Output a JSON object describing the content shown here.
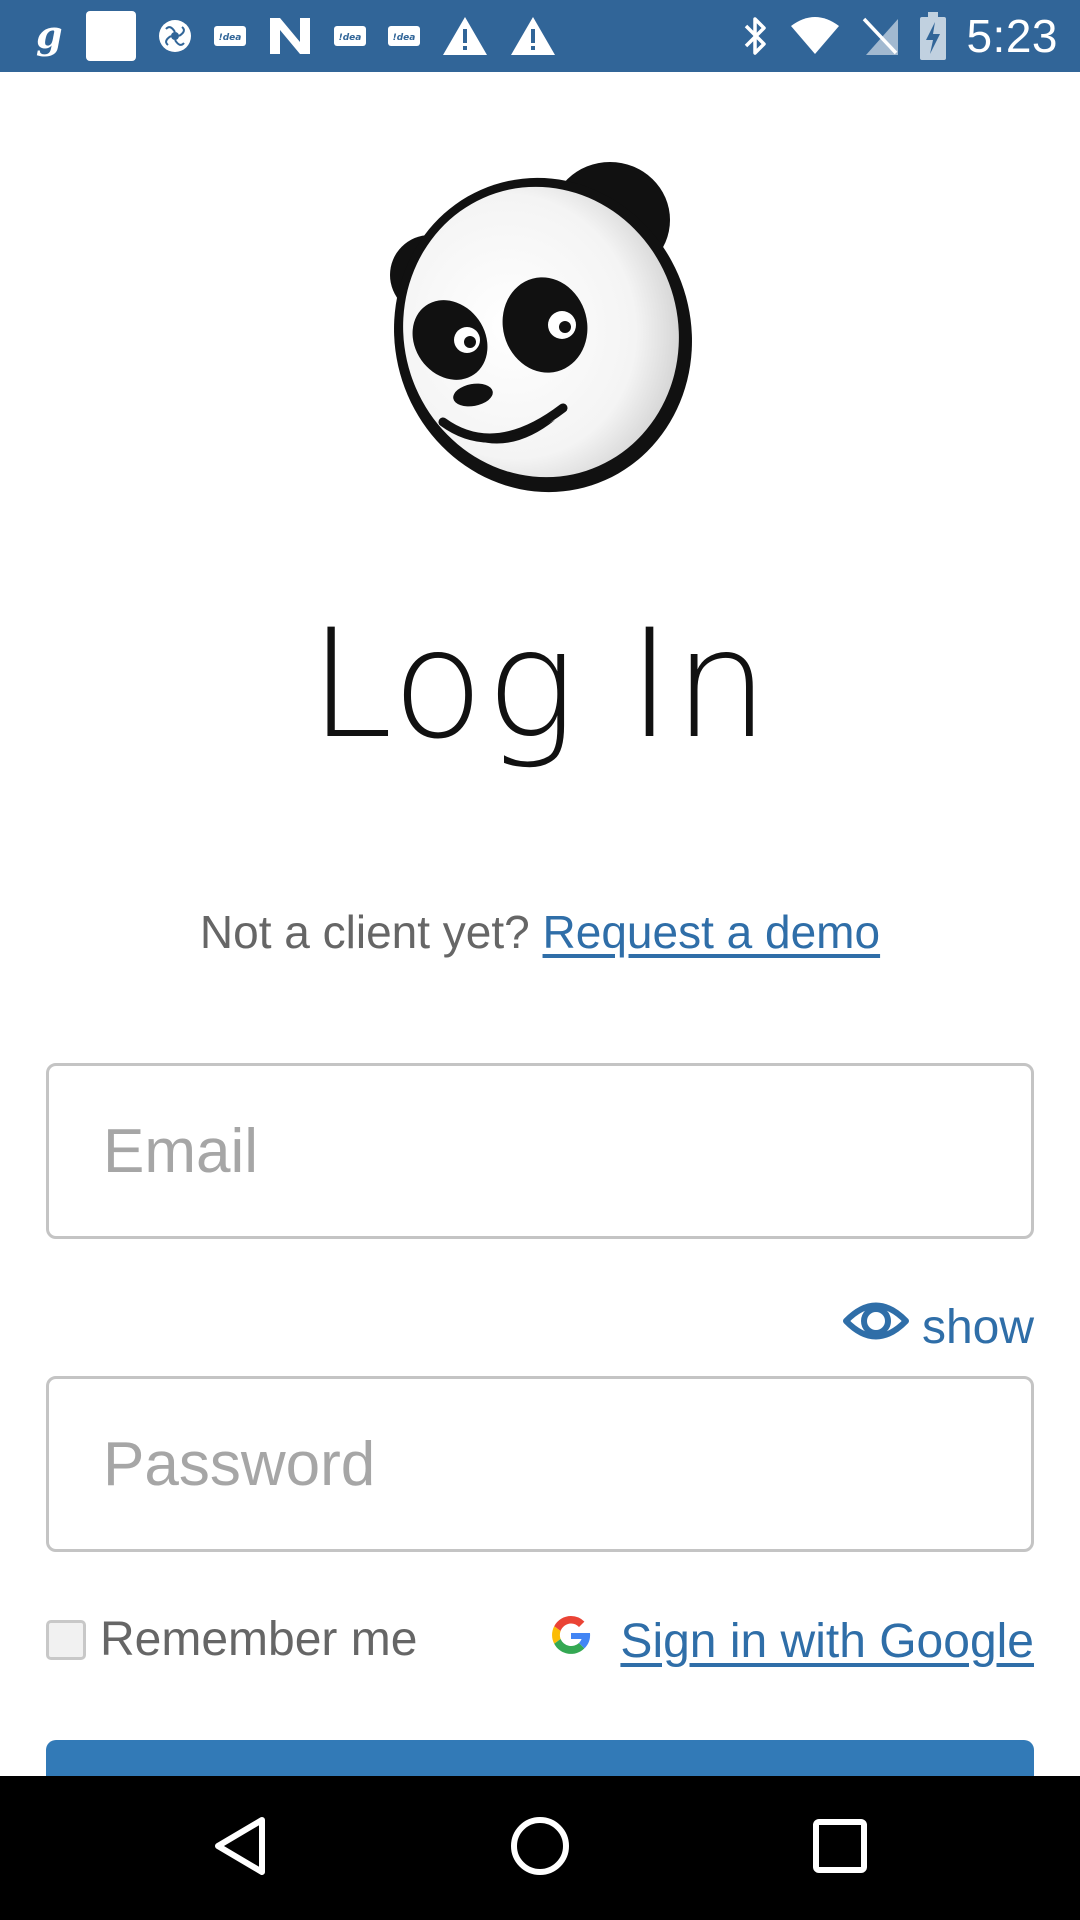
{
  "status_bar": {
    "time": "5:23",
    "left_icons": [
      "g-icon",
      "white-square-icon",
      "fan-icon",
      "idea-icon",
      "n-icon",
      "idea-icon",
      "idea-icon",
      "warning-icon",
      "warning-icon"
    ],
    "idea_label": "!dea",
    "right_icons": [
      "bluetooth-icon",
      "wifi-icon",
      "no-sim-icon",
      "battery-charging-icon"
    ],
    "background": "#316598"
  },
  "login": {
    "title": "Log In",
    "demo_prompt": "Not a client yet?",
    "demo_link": "Request a demo",
    "email_placeholder": "Email",
    "password_placeholder": "Password",
    "show_label": "show",
    "remember_label": "Remember me",
    "google_label": "Sign in with Google",
    "login_button_label": ""
  },
  "colors": {
    "link": "#2f6ea8",
    "button": "#327ab7",
    "placeholder": "#a6a6a6"
  },
  "nav_bar": {
    "buttons": [
      "back-icon",
      "home-icon",
      "recents-icon"
    ]
  }
}
